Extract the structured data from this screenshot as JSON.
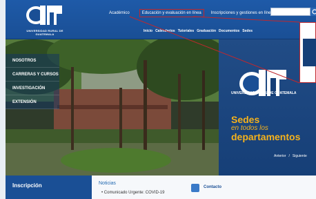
{
  "brand": {
    "name": "UNIVERSIDAD RURAL DE GUATEMALA"
  },
  "topnav": {
    "item1": "Académico",
    "item2": "Educación y evaluación en línea",
    "item3": "Inscripciones y gestiones en línea"
  },
  "subnav": [
    "Inicio",
    "Calendarios",
    "Tutoriales",
    "Graduación",
    "Documentos",
    "Sedes"
  ],
  "sidebar": {
    "items": [
      {
        "label": "NOSOTROS"
      },
      {
        "label": "CARRERAS Y CURSOS"
      },
      {
        "label": "INVESTIGACIÓN"
      },
      {
        "label": "EXTENSIÓN"
      }
    ]
  },
  "right_panel": {
    "logo_text": "UNIVERSIDAD RURAL DE GUATEMALA",
    "line1": "Sedes",
    "line2": "en todos los",
    "line3": "departamentos",
    "prev": "Anterior",
    "sep": "/",
    "next": "Siguiente"
  },
  "bottom": {
    "inscripcion": "Inscripción",
    "noticias": "Noticias",
    "noticias_item": "• Comunicado Urgente: COVID-19",
    "contacto": "Contacto"
  },
  "icons": {
    "search": "search-icon",
    "contacto": "contact-icon"
  },
  "colors": {
    "brand_blue": "#1a4f95",
    "accent_orange": "#f6b21b",
    "highlight_red": "#c0282d"
  }
}
